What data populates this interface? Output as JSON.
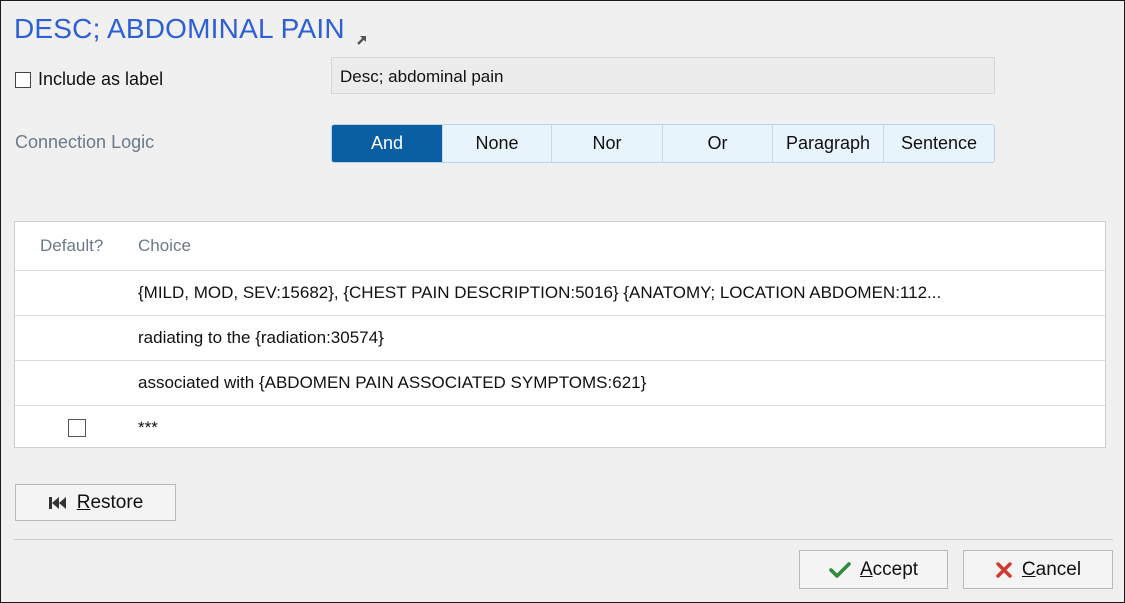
{
  "dialog": {
    "title": "DESC; ABDOMINAL PAIN"
  },
  "include_label": {
    "text": "Include as label",
    "checked": false,
    "field_value": "Desc; abdominal pain"
  },
  "connection_logic": {
    "label": "Connection Logic",
    "options": [
      "And",
      "None",
      "Nor",
      "Or",
      "Paragraph",
      "Sentence"
    ],
    "selected": "And"
  },
  "grid": {
    "headers": {
      "default": "Default?",
      "choice": "Choice"
    },
    "rows": [
      {
        "choice": "{MILD, MOD, SEV:15682}, {CHEST PAIN DESCRIPTION:5016} {ANATOMY; LOCATION ABDOMEN:112...",
        "has_checkbox": false
      },
      {
        "choice": "radiating to the {radiation:30574}",
        "has_checkbox": false
      },
      {
        "choice": "associated with {ABDOMEN PAIN ASSOCIATED SYMPTOMS:621}",
        "has_checkbox": false
      },
      {
        "choice": "***",
        "has_checkbox": true
      }
    ]
  },
  "buttons": {
    "restore_prefix": "",
    "restore_underline": "R",
    "restore_rest": "estore",
    "accept_underline": "A",
    "accept_rest": "ccept",
    "cancel_underline": "C",
    "cancel_rest": "ancel"
  },
  "colors": {
    "title": "#2e5fd6",
    "segment_active": "#0a5fa3",
    "segment_bg": "#e8f4fc",
    "accept_icon": "#2e8b3e",
    "cancel_icon": "#d0392b"
  },
  "icons": {
    "title_link": "popout-arrow-icon",
    "restore": "skip-to-start-icon",
    "accept": "checkmark-icon",
    "cancel": "x-icon"
  }
}
